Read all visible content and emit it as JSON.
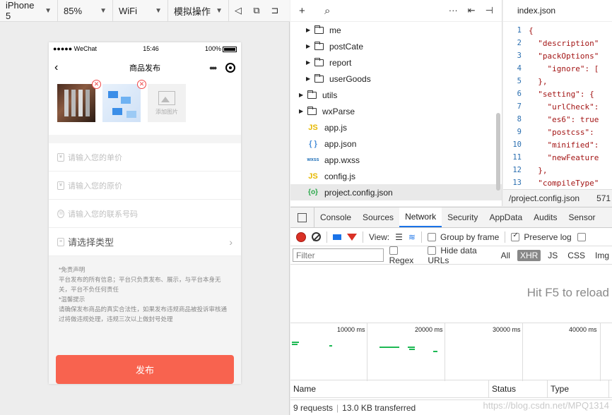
{
  "sim_toolbar": {
    "device": "iPhone 5",
    "zoom": "85%",
    "network": "WiFi",
    "operation": "模拟操作"
  },
  "phone": {
    "status": {
      "carrier": "●●●●● WeChat",
      "time": "15:46",
      "battery": "100%"
    },
    "nav_title": "商品发布",
    "add_image_label": "添加图片",
    "fields": {
      "price_placeholder": "请输入您的单价",
      "original_price_placeholder": "请输入您的原价",
      "phone_placeholder": "请输入您的联系号码",
      "type_label": "请选择类型"
    },
    "notice": {
      "disclaimer_title": "*免责声明",
      "disclaimer_text": "平台发布的所有信息；平台只负责发布、展示，与平台本身无关，平台不负任何责任",
      "tip_title": "*温馨提示",
      "tip_text": "请确保发布商品的真实合法性，如果发布违规商品被投诉审核通过将做违规处理，违规三次以上做封号处理"
    },
    "submit_label": "发布"
  },
  "tree": {
    "nodes": [
      {
        "name": "me",
        "kind": "folder"
      },
      {
        "name": "postCate",
        "kind": "folder"
      },
      {
        "name": "report",
        "kind": "folder"
      },
      {
        "name": "userGoods",
        "kind": "folder"
      },
      {
        "name": "utils",
        "kind": "folder"
      },
      {
        "name": "wxParse",
        "kind": "folder"
      },
      {
        "name": "app.js",
        "kind": "js",
        "icon": "JS"
      },
      {
        "name": "app.json",
        "kind": "json",
        "icon": "{ }"
      },
      {
        "name": "app.wxss",
        "kind": "wxss",
        "icon": "wxss"
      },
      {
        "name": "config.js",
        "kind": "js",
        "icon": "JS"
      },
      {
        "name": "project.config.json",
        "kind": "cfg",
        "icon": "{o}"
      }
    ]
  },
  "editor": {
    "tab_title": "index.json",
    "lines": [
      {
        "n": "1",
        "t": "{"
      },
      {
        "n": "2",
        "t": "  \"description\""
      },
      {
        "n": "3",
        "t": "  \"packOptions\""
      },
      {
        "n": "4",
        "t": "    \"ignore\": ["
      },
      {
        "n": "5",
        "t": "  },"
      },
      {
        "n": "6",
        "t": "  \"setting\": {"
      },
      {
        "n": "7",
        "t": "    \"urlCheck\":"
      },
      {
        "n": "8",
        "t": "    \"es6\": true"
      },
      {
        "n": "9",
        "t": "    \"postcss\":"
      },
      {
        "n": "10",
        "t": "    \"minified\":"
      },
      {
        "n": "11",
        "t": "    \"newFeature"
      },
      {
        "n": "12",
        "t": "  },"
      },
      {
        "n": "13",
        "t": "  \"compileType\""
      }
    ],
    "status_path": "/project.config.json",
    "status_size": "571"
  },
  "devtools": {
    "tabs": [
      "Console",
      "Sources",
      "Network",
      "Security",
      "AppData",
      "Audits",
      "Sensor"
    ],
    "active_tab": "Network",
    "controls": {
      "view_label": "View:",
      "group_by_frame": "Group by frame",
      "preserve_log": "Preserve log"
    },
    "filter": {
      "placeholder": "Filter",
      "regex": "Regex",
      "hide_data_urls": "Hide data URLs",
      "types": [
        "All",
        "XHR",
        "JS",
        "CSS",
        "Img"
      ]
    },
    "reload_message": "Hit F5 to reload",
    "timeline_ticks": [
      "10000 ms",
      "20000 ms",
      "30000 ms",
      "40000 ms"
    ],
    "columns": [
      "Name",
      "Status",
      "Type"
    ],
    "footer": {
      "requests": "9 requests",
      "transferred": "13.0 KB transferred"
    }
  },
  "watermark": "https://blog.csdn.net/MPQ1314"
}
